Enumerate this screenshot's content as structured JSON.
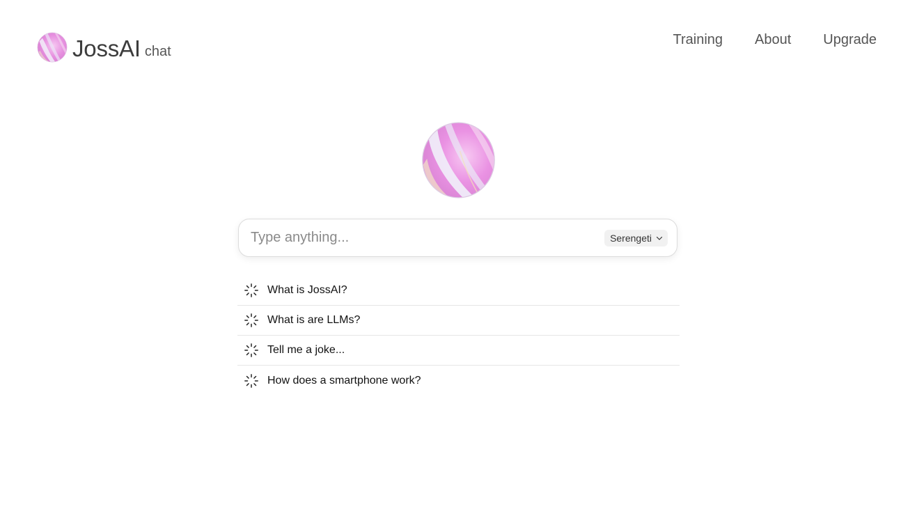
{
  "brand": {
    "name": "JossAI",
    "suffix": "chat",
    "logo_icon": "gradient-orb-icon"
  },
  "nav": {
    "items": [
      {
        "label": "Training"
      },
      {
        "label": "About"
      },
      {
        "label": "Upgrade"
      }
    ]
  },
  "hero": {
    "icon": "gradient-orb-icon"
  },
  "search": {
    "placeholder": "Type anything...",
    "value": "",
    "model_selected": "Serengeti",
    "dropdown_icon": "chevron-down-icon"
  },
  "suggestions": [
    {
      "label": "What is JossAI?",
      "icon": "spinner-icon"
    },
    {
      "label": "What is are LLMs?",
      "icon": "spinner-icon"
    },
    {
      "label": "Tell me a joke...",
      "icon": "spinner-icon"
    },
    {
      "label": "How does a smartphone work?",
      "icon": "spinner-icon"
    }
  ],
  "colors": {
    "orb_pink": "#e98ae0",
    "orb_highlight": "#f3eefb",
    "nav_text": "#555555",
    "divider": "#e6e6e6"
  }
}
